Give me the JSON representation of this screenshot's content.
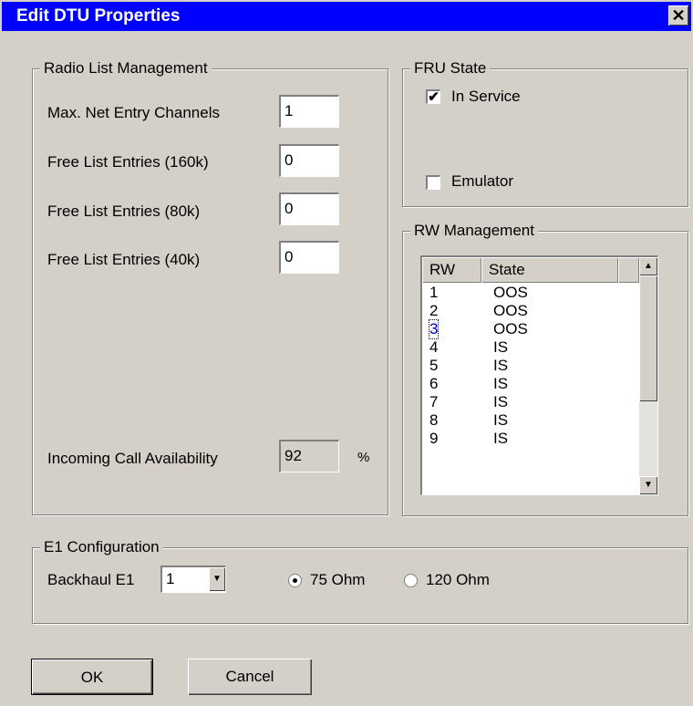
{
  "window": {
    "title": "Edit DTU Properties",
    "close_glyph": "✕"
  },
  "radio_list": {
    "title": "Radio List Management",
    "max_net_entry_label": "Max. Net Entry Channels",
    "max_net_entry_value": "1",
    "free_160k_label": "Free List Entries (160k)",
    "free_160k_value": "0",
    "free_80k_label": "Free List Entries (80k)",
    "free_80k_value": "0",
    "free_40k_label": "Free List Entries (40k)",
    "free_40k_value": "0",
    "incoming_label": "Incoming Call Availability",
    "incoming_value": "92",
    "incoming_unit": "%"
  },
  "fru_state": {
    "title": "FRU State",
    "in_service_label": "In Service",
    "in_service_checked": true,
    "emulator_label": "Emulator",
    "emulator_checked": false
  },
  "rw_management": {
    "title": "RW Management",
    "columns": [
      "RW",
      "State"
    ],
    "rows": [
      {
        "rw": "1",
        "state": "OOS"
      },
      {
        "rw": "2",
        "state": "OOS"
      },
      {
        "rw": "3",
        "state": "OOS"
      },
      {
        "rw": "4",
        "state": "IS"
      },
      {
        "rw": "5",
        "state": "IS"
      },
      {
        "rw": "6",
        "state": "IS"
      },
      {
        "rw": "7",
        "state": "IS"
      },
      {
        "rw": "8",
        "state": "IS"
      },
      {
        "rw": "9",
        "state": "IS"
      }
    ],
    "selected_row": 2
  },
  "e1_config": {
    "title": "E1 Configuration",
    "backhaul_label": "Backhaul E1",
    "backhaul_value": "1",
    "ohm75_label": "75 Ohm",
    "ohm120_label": "120 Ohm",
    "selected": "75 Ohm"
  },
  "buttons": {
    "ok": "OK",
    "cancel": "Cancel"
  },
  "colors": {
    "titlebar": "#0000ff",
    "face": "#d4d0c8"
  }
}
